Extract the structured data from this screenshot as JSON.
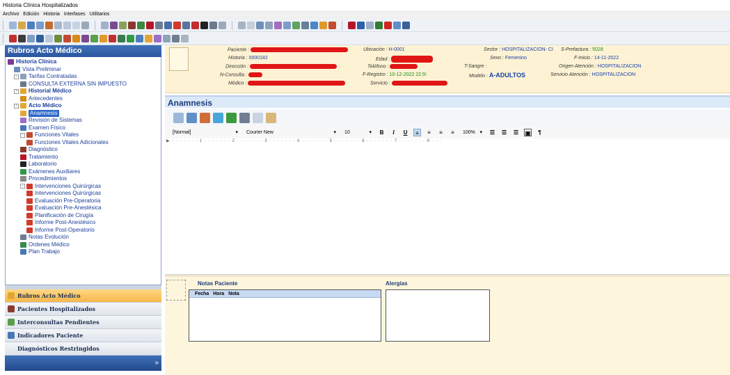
{
  "window": {
    "title": "Historia Clínica Hospitalizados"
  },
  "menu": [
    "Archivo",
    "Edición",
    "Historia",
    "Interfases",
    "Utilitarios"
  ],
  "left_panel": {
    "title": "Rubros Acto Médico",
    "tree": [
      {
        "label": "Historia Clínica",
        "level": 0,
        "bold": true,
        "icon": "history-icon",
        "color": "#7a3b96"
      },
      {
        "label": "Vista Preliminar",
        "level": 1,
        "icon": "preview-icon",
        "color": "#6d8fb8"
      },
      {
        "label": "Tarifas Contratadas",
        "level": 1,
        "expander": "-",
        "icon": "tariff-icon",
        "color": "#8aa0be"
      },
      {
        "label": "CONSULTA EXTERNA SIN IMPUESTO",
        "level": 2,
        "icon": "consult-icon",
        "color": "#6a7a8c"
      },
      {
        "label": "Historial Médico",
        "level": 1,
        "bold": true,
        "expander": "-",
        "icon": "folder-icon",
        "color": "#e3a635"
      },
      {
        "label": "Antecedentes",
        "level": 2,
        "icon": "antecedent-icon",
        "color": "#d58b15"
      },
      {
        "label": "Acto Médico",
        "level": 1,
        "bold": true,
        "expander": "-",
        "icon": "folder-icon",
        "color": "#e3a635"
      },
      {
        "label": "Anamnesis",
        "level": 2,
        "selected": true,
        "icon": "folder-icon",
        "color": "#e3a635"
      },
      {
        "label": "Revisión de Sistemas",
        "level": 2,
        "icon": "system-review-icon",
        "color": "#9a6ec9"
      },
      {
        "label": "Examen Físico",
        "level": 2,
        "icon": "exam-icon",
        "color": "#4877b4"
      },
      {
        "label": "Funciones Vitales",
        "level": 2,
        "expander": "-",
        "icon": "vitals-icon",
        "color": "#c24a2e"
      },
      {
        "label": "Funciones Vitales Adicionales",
        "level": 3,
        "icon": "vitals-icon",
        "color": "#c24a2e"
      },
      {
        "label": "Diagnóstico",
        "level": 2,
        "icon": "diagnosis-icon",
        "color": "#8a3a2c"
      },
      {
        "label": "Tratamiento",
        "level": 2,
        "icon": "treatment-icon",
        "color": "#b5172a"
      },
      {
        "label": "Laboratorio",
        "level": 2,
        "icon": "lab-icon",
        "color": "#222222"
      },
      {
        "label": "Exámenes Auxiliares",
        "level": 2,
        "icon": "aux-exam-icon",
        "color": "#2f9a45"
      },
      {
        "label": "Procedimientos",
        "level": 2,
        "icon": "procedure-icon",
        "color": "#8a8a8a"
      },
      {
        "label": "Intervenciones Quirúrgicas",
        "level": 2,
        "expander": "-",
        "icon": "surgery-icon",
        "color": "#d23a2a"
      },
      {
        "label": "Intervenciones Quirúrgicas",
        "level": 3,
        "icon": "surgery-icon",
        "color": "#d23a2a"
      },
      {
        "label": "Evaluación Pre-Operatoria",
        "level": 3,
        "icon": "surgery-icon",
        "color": "#d23a2a"
      },
      {
        "label": "Evaluación Pre-Anestésica",
        "level": 3,
        "icon": "surgery-icon",
        "color": "#d23a2a"
      },
      {
        "label": "Planificación de Cirugía",
        "level": 3,
        "icon": "surgery-icon",
        "color": "#d23a2a"
      },
      {
        "label": "Informe Post-Anestésico",
        "level": 3,
        "icon": "surgery-icon",
        "color": "#d23a2a"
      },
      {
        "label": "Informe Post-Operatorio",
        "level": 3,
        "icon": "surgery-icon",
        "color": "#d23a2a"
      },
      {
        "label": "Notas Evolución",
        "level": 2,
        "icon": "notes-icon",
        "color": "#6f7e91"
      },
      {
        "label": "Ordenes Médico",
        "level": 2,
        "icon": "orders-icon",
        "color": "#3a8a4e"
      },
      {
        "label": "Plan Trabajo",
        "level": 2,
        "icon": "plan-icon",
        "color": "#4877b4"
      }
    ],
    "nav_buttons": [
      {
        "label": "Rubros Acto Médico",
        "active": true,
        "icon": "folder-icon",
        "color": "#e3a635"
      },
      {
        "label": "Pacientes Hospitalizados",
        "active": false,
        "icon": "patients-icon",
        "color": "#8a3a2c"
      },
      {
        "label": "Interconsultas Pendientes",
        "active": false,
        "icon": "interconsult-icon",
        "color": "#5aa04a"
      },
      {
        "label": "Indicadores Paciente",
        "active": false,
        "icon": "indicators-icon",
        "color": "#4877b4"
      },
      {
        "label": "Diagnósticos Restringidos",
        "active": false,
        "icon": "",
        "color": ""
      }
    ],
    "expand_glyph": "»"
  },
  "patient": {
    "paciente_label": "Paciente :",
    "historia_label": "Historia :",
    "historia": "0000182",
    "direccion_label": "Dirección :",
    "nconsulta_label": "N-Consulta :",
    "medico_label": "Médico :",
    "ubicacion_label": "Ubicación :",
    "ubicacion": "H-0001",
    "edad_label": "Edad :",
    "telefono_label": "Teléfono :",
    "fregistro_label": "F-Registro :",
    "fregistro": "10-12-2022  22:5!",
    "servicio_label": "Servicio :",
    "sector_label": "Sector :",
    "sector": "HOSPITALIZACION- CI",
    "sexo_label": "Sexo :",
    "sexo": "Femenino",
    "tsangre_label": "T-Sangre :",
    "modelo_label": "Modelo :",
    "modelo": "A-ADULTOS",
    "sprefactura_label": "S-Prefactura :",
    "sprefactura": "5028",
    "finicio_label": "F-Inicio :",
    "finicio": "14-11-2022",
    "origen_label": "Origen Atención :",
    "origen": "HOSPITALIZACION",
    "servatencion_label": "Servicio Atención :",
    "servatencion": "HOSPITALIZACION"
  },
  "section": {
    "title": "Anamnesis"
  },
  "format_bar": {
    "style": "[Normal]",
    "font": "Courier New",
    "size": "10",
    "zoom": "100%",
    "bold": "B",
    "italic": "I",
    "underline": "U",
    "pilcrow": "¶"
  },
  "ruler_text": "·  ·  ·  ·  ·  ·  ·  1  ·  ·  ·  ·  ·  ·  ·  2  ·  ·  ·  ·  ·  ·  ·  3  ·  ·  ·  ·  ·  ·  ·  4  ·  ·  ·  ·  ·  ·  ·  5  ·  ·  ·  ·  ·  ·  ·  6  ·  ·  ·  ·  ·  ·  ·  7  ·  ·  ·  ·  ·  ·  ·  8  ·  ·  ·",
  "bottom": {
    "notes_title": "Notas Paciente",
    "notes_columns": [
      "Fecha",
      "Hora",
      "Nota"
    ],
    "allergies_title": "Alergias"
  },
  "colors": {
    "accent": "#2a56a0",
    "selection": "#2a66c8",
    "patient_bg": "#fdf3d4",
    "value_blue": "#1840a8",
    "value_green": "#1a8a1a"
  }
}
